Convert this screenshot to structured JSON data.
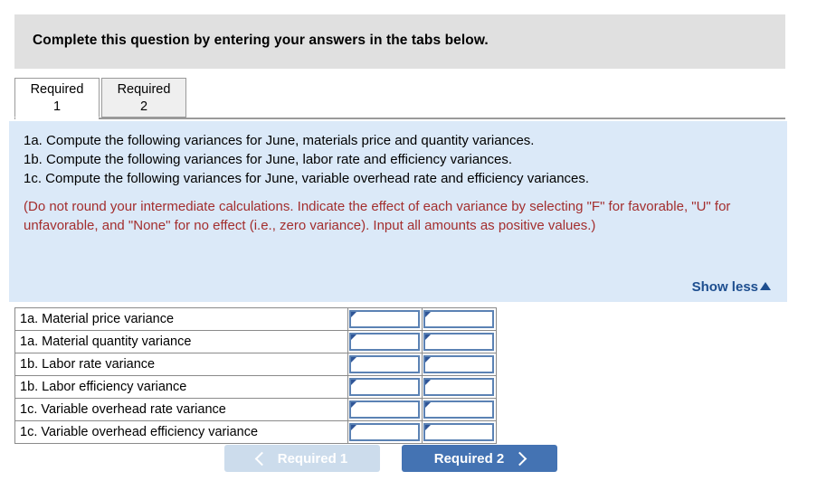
{
  "header": {
    "title": "Complete this question by entering your answers in the tabs below."
  },
  "tabs": [
    {
      "line1": "Required",
      "line2": "1",
      "active": true
    },
    {
      "line1": "Required",
      "line2": "2",
      "active": false
    }
  ],
  "instructions": {
    "lines": [
      "1a. Compute the following variances for June, materials price and quantity variances.",
      "1b. Compute the following variances for June, labor rate and efficiency variances.",
      "1c. Compute the following variances for June, variable overhead rate and efficiency variances."
    ],
    "note": "(Do not round your intermediate calculations. Indicate the effect of each variance by selecting \"F\" for favorable, \"U\" for unfavorable, and \"None\" for no effect (i.e., zero variance). Input all amounts as positive values.)",
    "toggle_label": "Show less",
    "toggle_icon": "caret-up-icon",
    "note_color": "#a32e2e",
    "panel_color": "#dbe9f8",
    "toggle_color": "#1d4e8f"
  },
  "answer_table": {
    "rows": [
      {
        "label": "1a. Material price variance",
        "amount": "",
        "effect": ""
      },
      {
        "label": "1a. Material quantity variance",
        "amount": "",
        "effect": ""
      },
      {
        "label": "1b. Labor rate variance",
        "amount": "",
        "effect": ""
      },
      {
        "label": "1b. Labor efficiency variance",
        "amount": "",
        "effect": ""
      },
      {
        "label": "1c. Variable overhead rate variance",
        "amount": "",
        "effect": ""
      },
      {
        "label": "1c. Variable overhead efficiency variance",
        "amount": "",
        "effect": ""
      }
    ]
  },
  "nav": {
    "prev_label": "Required 1",
    "prev_icon": "chevron-left-icon",
    "prev_disabled": true,
    "next_label": "Required 2",
    "next_icon": "chevron-right-icon",
    "next_color": "#4473b3",
    "prev_color": "#ccdcec"
  }
}
